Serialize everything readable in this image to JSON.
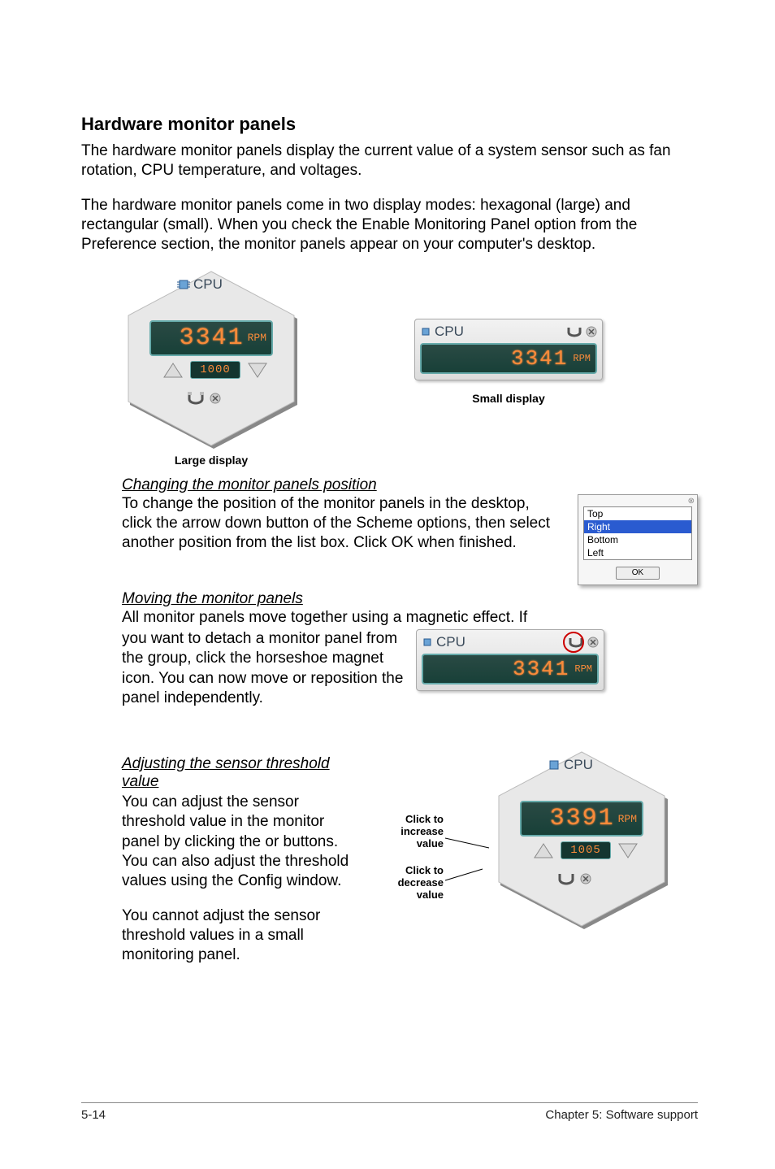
{
  "heading": "Hardware monitor panels",
  "para1": "The hardware monitor panels display the current value of a system sensor such as fan rotation, CPU temperature, and voltages.",
  "para2": "The hardware monitor panels come in two display modes: hexagonal (large) and rectangular (small). When you check the Enable Monitoring Panel option from the Preference section, the monitor panels appear on your computer's desktop.",
  "large_caption": "Large display",
  "small_caption": "Small display",
  "panel_label": "CPU",
  "large_value": "3341",
  "large_unit": "RPM",
  "large_threshold": "1000",
  "small_value": "3341",
  "small_unit": "RPM",
  "detach_value": "3341",
  "detach_unit": "RPM",
  "adjust_value": "3391",
  "adjust_unit": "RPM",
  "adjust_threshold": "1005",
  "sec1_h": "Changing the monitor panels position",
  "sec1_p": "To change the position of the monitor panels in the desktop, click the arrow down button of the Scheme options, then select another position from the list box. Click OK when finished.",
  "sec2_h": "Moving the monitor panels",
  "sec2_p1": "All monitor panels move together using a magnetic effect. If",
  "sec2_p2": "you want to detach a monitor panel from the group, click the horseshoe magnet icon. You can now move or reposition the panel independently.",
  "sec3_h": "Adjusting the sensor threshold value",
  "sec3_p1": "You can adjust the sensor threshold value in the monitor panel by clicking the  or  buttons. You can also adjust the threshold values using the Config window.",
  "sec3_p2": "You cannot adjust the sensor threshold values in a small monitoring panel.",
  "scheme_options": [
    "Top",
    "Right",
    "Bottom",
    "Left"
  ],
  "scheme_selected_index": 1,
  "scheme_ok": "OK",
  "click_inc": "Click to increase value",
  "click_dec": "Click to decrease value",
  "footer_left": "5-14",
  "footer_right": "Chapter 5: Software support"
}
